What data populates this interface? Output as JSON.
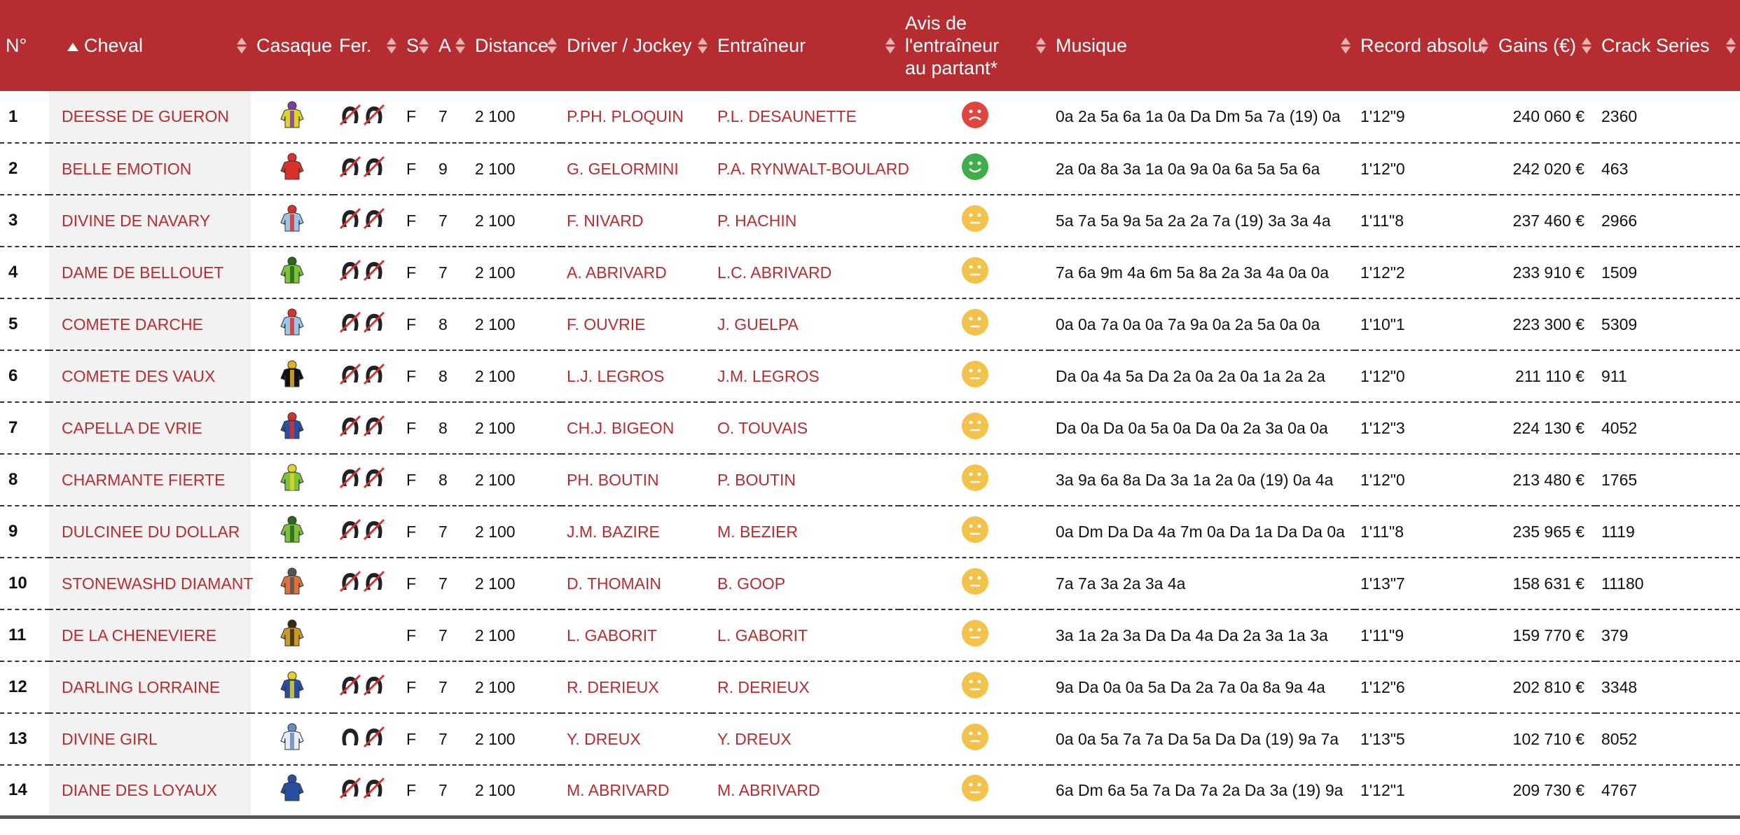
{
  "colors": {
    "header_bg": "#b52d30",
    "accent_red": "#b52d30",
    "sad": "#e0463e",
    "happy": "#3fae49",
    "neutral": "#f3c24a"
  },
  "headers": {
    "num": "N°",
    "cheval": "Cheval",
    "casaque": "Casaque",
    "fer": "Fer.",
    "s": "S",
    "a": "A",
    "distance": "Distance",
    "driver": "Driver / Jockey",
    "entraineur": "Entraîneur",
    "avis": "Avis de l'entraîneur au partant*",
    "musique": "Musique",
    "record": "Record absolu",
    "gains": "Gains (€)",
    "crack": "Crack Series"
  },
  "rows": [
    {
      "num": "1",
      "cheval": "DEESSE DE GUERON",
      "jersey": [
        "#e0d42a",
        "#7b3fa0"
      ],
      "fer": "both-removed",
      "s": "F",
      "a": "7",
      "distance": "2 100",
      "driver": "P.PH. PLOQUIN",
      "entraineur": "P.L. DESAUNETTE",
      "avis": "sad",
      "musique": "0a 2a 5a 6a 1a 0a Da Dm 5a 7a (19) 0a",
      "record": "1'12\"9",
      "gains": "240 060 €",
      "crack": "2360"
    },
    {
      "num": "2",
      "cheval": "BELLE EMOTION",
      "jersey": [
        "#d8322d",
        "#d8322d"
      ],
      "fer": "both-removed",
      "s": "F",
      "a": "9",
      "distance": "2 100",
      "driver": "G. GELORMINI",
      "entraineur": "P.A. RYNWALT-BOULARD",
      "avis": "happy",
      "musique": "2a 0a 8a 3a 1a 0a 9a 0a 6a 5a 5a 6a",
      "record": "1'12\"0",
      "gains": "242 020 €",
      "crack": "463"
    },
    {
      "num": "3",
      "cheval": "DIVINE DE NAVARY",
      "jersey": [
        "#9cc6e8",
        "#d8322d"
      ],
      "fer": "both-removed",
      "s": "F",
      "a": "7",
      "distance": "2 100",
      "driver": "F. NIVARD",
      "entraineur": "P. HACHIN",
      "avis": "neutral",
      "musique": "5a 7a 5a 9a 5a 2a 2a 7a (19) 3a 3a 4a",
      "record": "1'11\"8",
      "gains": "237 460 €",
      "crack": "2966"
    },
    {
      "num": "4",
      "cheval": "DAME DE BELLOUET",
      "jersey": [
        "#7cc23a",
        "#2a6a1a"
      ],
      "fer": "both-removed",
      "s": "F",
      "a": "7",
      "distance": "2 100",
      "driver": "A. ABRIVARD",
      "entraineur": "L.C. ABRIVARD",
      "avis": "neutral",
      "musique": "7a 6a 9m 4a 6m 5a 8a 2a 3a 4a 0a 0a",
      "record": "1'12\"2",
      "gains": "233 910 €",
      "crack": "1509"
    },
    {
      "num": "5",
      "cheval": "COMETE DARCHE",
      "jersey": [
        "#9cc6e8",
        "#d8322d"
      ],
      "fer": "both-removed",
      "s": "F",
      "a": "8",
      "distance": "2 100",
      "driver": "F. OUVRIE",
      "entraineur": "J. GUELPA",
      "avis": "neutral",
      "musique": "0a 0a 7a 0a 0a 7a 9a 0a 2a 5a 0a 0a",
      "record": "1'10\"1",
      "gains": "223 300 €",
      "crack": "5309"
    },
    {
      "num": "6",
      "cheval": "COMETE DES VAUX",
      "jersey": [
        "#111111",
        "#e0b020"
      ],
      "fer": "both-removed",
      "s": "F",
      "a": "8",
      "distance": "2 100",
      "driver": "L.J. LEGROS",
      "entraineur": "J.M. LEGROS",
      "avis": "neutral",
      "musique": "Da 0a 4a 5a Da 2a 0a 2a 0a 1a 2a 2a",
      "record": "1'12\"0",
      "gains": "211 110 €",
      "crack": "911"
    },
    {
      "num": "7",
      "cheval": "CAPELLA DE VRIE",
      "jersey": [
        "#2b4fa0",
        "#d8322d"
      ],
      "fer": "both-removed",
      "s": "F",
      "a": "8",
      "distance": "2 100",
      "driver": "CH.J. BIGEON",
      "entraineur": "O. TOUVAIS",
      "avis": "neutral",
      "musique": "Da 0a Da 0a 5a 0a Da 0a 2a 3a 0a 0a",
      "record": "1'12\"3",
      "gains": "224 130 €",
      "crack": "4052"
    },
    {
      "num": "8",
      "cheval": "CHARMANTE FIERTE",
      "jersey": [
        "#7cc23a",
        "#e0d42a"
      ],
      "fer": "both-removed",
      "s": "F",
      "a": "8",
      "distance": "2 100",
      "driver": "PH. BOUTIN",
      "entraineur": "P. BOUTIN",
      "avis": "neutral",
      "musique": "3a 9a 6a 8a Da 3a 1a 2a 0a (19) 0a 4a",
      "record": "1'12\"0",
      "gains": "213 480 €",
      "crack": "1765"
    },
    {
      "num": "9",
      "cheval": "DULCINEE DU DOLLAR",
      "jersey": [
        "#7cc23a",
        "#2a6a1a"
      ],
      "fer": "both-removed",
      "s": "F",
      "a": "7",
      "distance": "2 100",
      "driver": "J.M. BAZIRE",
      "entraineur": "M. BEZIER",
      "avis": "neutral",
      "musique": "0a Dm Da Da 4a 7m 0a Da 1a Da Da 0a",
      "record": "1'11\"8",
      "gains": "235 965 €",
      "crack": "1119"
    },
    {
      "num": "10",
      "cheval": "STONEWASHD DIAMANT",
      "jersey": [
        "#e0703a",
        "#555555"
      ],
      "fer": "both-removed",
      "s": "F",
      "a": "7",
      "distance": "2 100",
      "driver": "D. THOMAIN",
      "entraineur": "B. GOOP",
      "avis": "neutral",
      "musique": "7a 7a 3a 2a 3a 4a",
      "record": "1'13\"7",
      "gains": "158 631 €",
      "crack": "11180"
    },
    {
      "num": "11",
      "cheval": "DE LA CHENEVIERE",
      "jersey": [
        "#c99a2a",
        "#3a2a10"
      ],
      "fer": "none",
      "s": "F",
      "a": "7",
      "distance": "2 100",
      "driver": "L. GABORIT",
      "entraineur": "L. GABORIT",
      "avis": "neutral",
      "musique": "3a 1a 2a 3a Da Da 4a Da 2a 3a 1a 3a",
      "record": "1'11\"9",
      "gains": "159 770 €",
      "crack": "379"
    },
    {
      "num": "12",
      "cheval": "DARLING LORRAINE",
      "jersey": [
        "#2b4fa0",
        "#e0d42a"
      ],
      "fer": "both-removed",
      "s": "F",
      "a": "7",
      "distance": "2 100",
      "driver": "R. DERIEUX",
      "entraineur": "R. DERIEUX",
      "avis": "neutral",
      "musique": "9a Da 0a 0a 5a Da 2a 7a 0a 8a 9a 4a",
      "record": "1'12\"6",
      "gains": "202 810 €",
      "crack": "3348"
    },
    {
      "num": "13",
      "cheval": "DIVINE GIRL",
      "jersey": [
        "#e8eef6",
        "#6a8ac0"
      ],
      "fer": "back-removed",
      "s": "F",
      "a": "7",
      "distance": "2 100",
      "driver": "Y. DREUX",
      "entraineur": "Y. DREUX",
      "avis": "neutral",
      "musique": "0a 0a 5a 7a 7a Da 5a Da Da (19) 9a 7a",
      "record": "1'13\"5",
      "gains": "102 710 €",
      "crack": "8052"
    },
    {
      "num": "14",
      "cheval": "DIANE DES LOYAUX",
      "jersey": [
        "#2b4fa0",
        "#2b4fa0"
      ],
      "fer": "both-removed",
      "s": "F",
      "a": "7",
      "distance": "2 100",
      "driver": "M. ABRIVARD",
      "entraineur": "M. ABRIVARD",
      "avis": "neutral",
      "musique": "6a Dm 6a 5a 7a Da 7a 2a Da 3a (19) 9a",
      "record": "1'12\"1",
      "gains": "209 730 €",
      "crack": "4767"
    }
  ]
}
